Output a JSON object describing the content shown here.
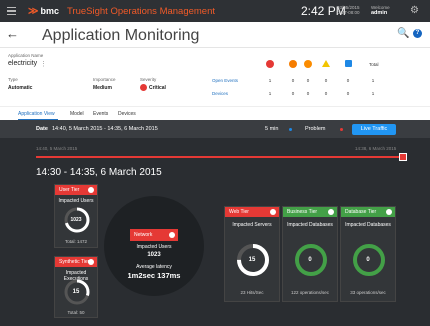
{
  "topbar": {
    "brand_logo": "≫",
    "brand_name": "bmc",
    "product": "TrueSight Operations Management",
    "clock": "2:42 PM",
    "date_line1": "03/05/2015",
    "date_line2": "GMT-08:00",
    "welcome_label": "Welcome",
    "user": "admin"
  },
  "header": {
    "title": "Application Monitoring"
  },
  "info": {
    "app_name_label": "Application Name",
    "app_name": "electricity",
    "type_label": "Type",
    "type_value": "Automatic",
    "importance_label": "Importance",
    "importance_value": "Medium",
    "severity_label": "Severity",
    "severity_value": "Critical",
    "events_label": "Open Events",
    "devices_label": "Devices",
    "total_label": "Total",
    "events_counts": [
      "1",
      "0",
      "0",
      "0",
      "0",
      "1"
    ],
    "devices_counts": [
      "1",
      "0",
      "0",
      "0",
      "0",
      "1"
    ]
  },
  "tabs": [
    "Application View",
    "Model",
    "Events",
    "Devices"
  ],
  "datebar": {
    "label": "Date",
    "value": "14:40, 5 March 2015 - 14:35, 6 March 2015",
    "interval": "5 min",
    "filter": "Problem",
    "live": "Live Traffic"
  },
  "timeline": {
    "left": "14:40, 5 March 2015",
    "right": "14:38, 6 March 2015"
  },
  "range_title": "14:30 - 14:35, 6 March 2015",
  "colors": {
    "critical": "#e53935",
    "ok": "#43a047",
    "accent": "#2196f3"
  },
  "tiers": {
    "user": {
      "name": "User Tier",
      "sub": "Impacted Users",
      "value": "1023",
      "foot": "Total: 1472",
      "fraction": 0.7
    },
    "synthetic": {
      "name": "Synthetic Tier",
      "sub": "Impacted Executions",
      "value": "15",
      "foot": "Total: 50",
      "fraction": 0.3
    },
    "network": {
      "name": "Network",
      "sub": "Impacted Users",
      "value": "1023",
      "latency_label": "Average latency",
      "latency": "1m2sec 137ms"
    },
    "web": {
      "name": "Web Tier",
      "sub": "Impacted Servers",
      "value": "15",
      "foot": "23 Hits/Sec",
      "fraction": 0.75
    },
    "business": {
      "name": "Business Tier",
      "sub": "Impacted Databases",
      "value": "0",
      "foot": "122 operations/sec",
      "fraction": 0
    },
    "database": {
      "name": "Database Tier",
      "sub": "Impacted Databases",
      "value": "0",
      "foot": "33 operations/sec",
      "fraction": 0
    }
  }
}
